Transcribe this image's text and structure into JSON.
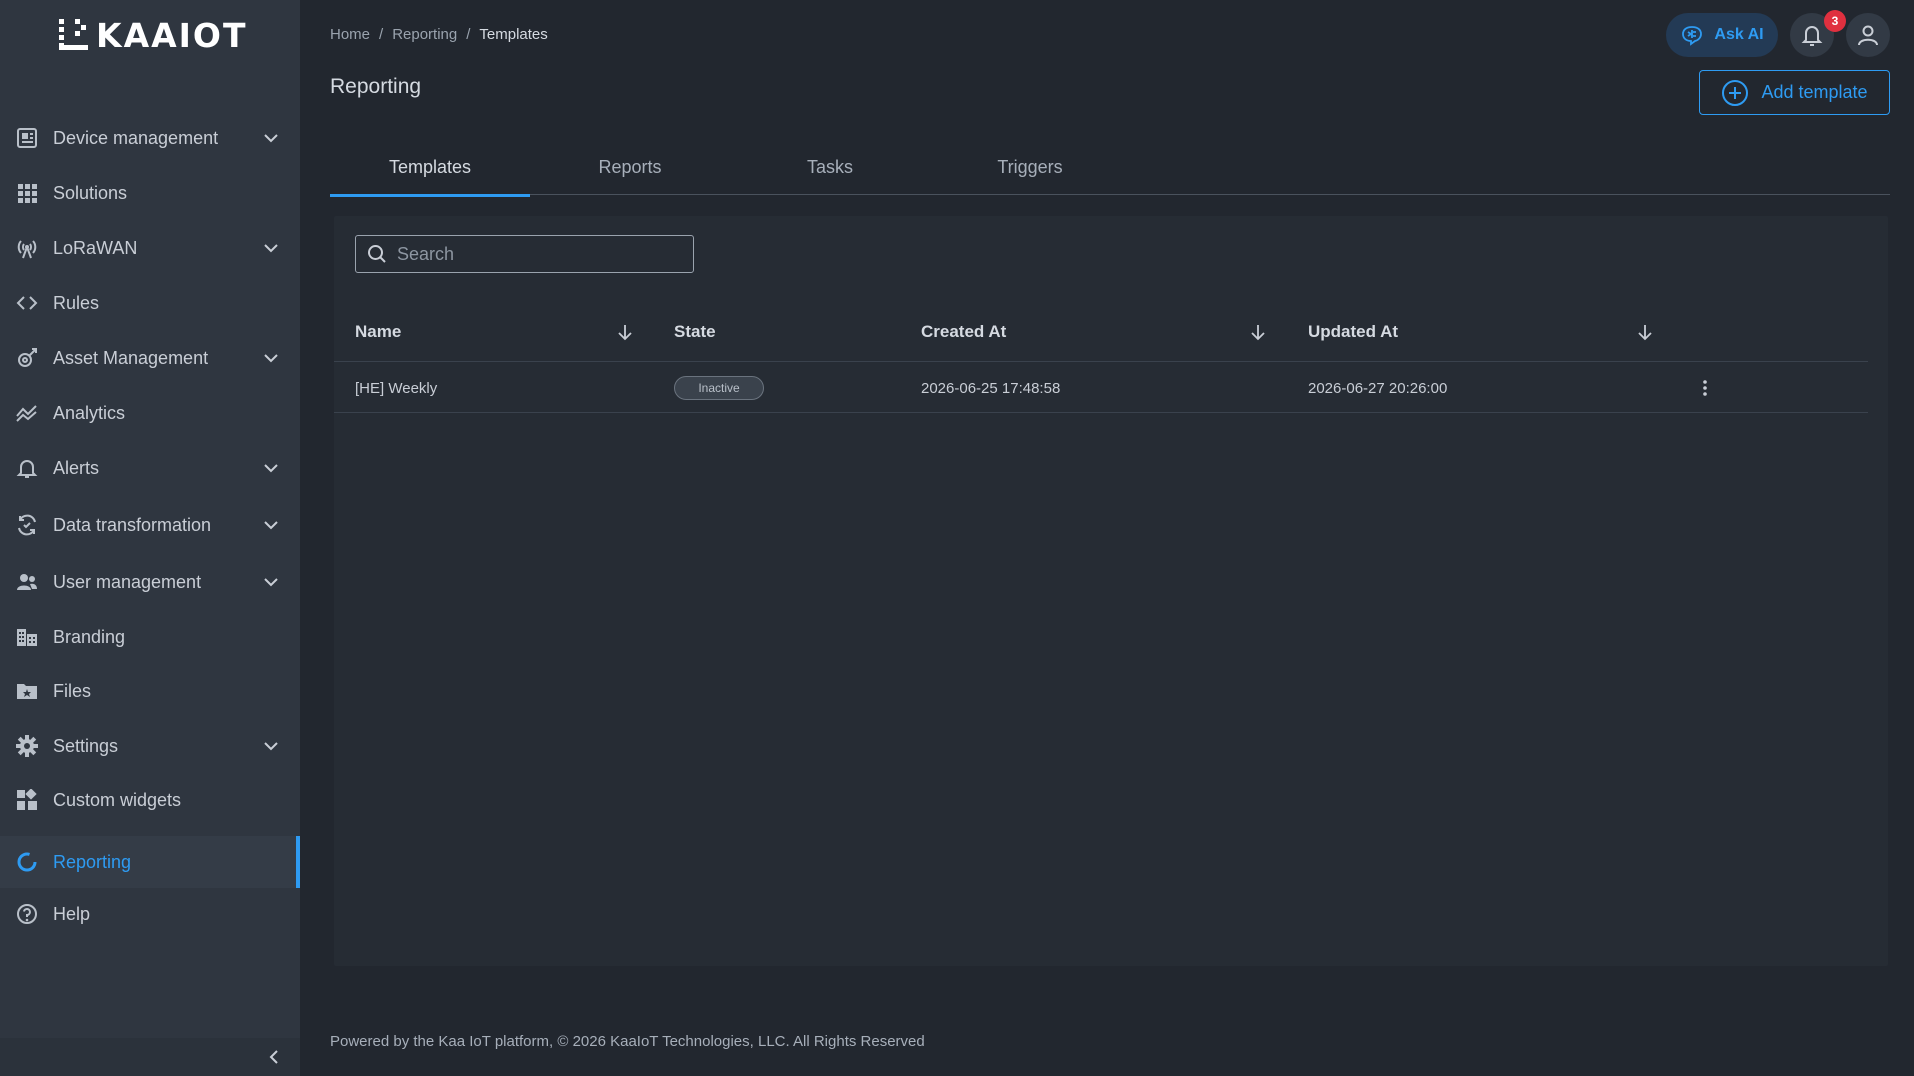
{
  "brand": {
    "logo_text": "KAAIOT",
    "accent_color": "#2e9bf2"
  },
  "sidebar": {
    "items": [
      {
        "label": "Device management",
        "icon": "device-icon",
        "expandable": true
      },
      {
        "label": "Solutions",
        "icon": "grid-icon",
        "expandable": false
      },
      {
        "label": "LoRaWAN",
        "icon": "antenna-icon",
        "expandable": true
      },
      {
        "label": "Rules",
        "icon": "code-icon",
        "expandable": false
      },
      {
        "label": "Asset Management",
        "icon": "asset-icon",
        "expandable": true
      },
      {
        "label": "Analytics",
        "icon": "analytics-icon",
        "expandable": false
      },
      {
        "label": "Alerts",
        "icon": "bell-icon",
        "expandable": true
      },
      {
        "label": "Data transformation",
        "icon": "transform-icon",
        "expandable": true
      },
      {
        "label": "User management",
        "icon": "users-icon",
        "expandable": true
      },
      {
        "label": "Branding",
        "icon": "branding-icon",
        "expandable": false
      },
      {
        "label": "Files",
        "icon": "folder-icon",
        "expandable": false
      },
      {
        "label": "Settings",
        "icon": "gear-icon",
        "expandable": true
      },
      {
        "label": "Custom widgets",
        "icon": "widgets-icon",
        "expandable": false
      },
      {
        "label": "Reporting",
        "icon": "reporting-icon",
        "expandable": false,
        "active": true
      },
      {
        "label": "Help",
        "icon": "help-icon",
        "expandable": false
      }
    ]
  },
  "header": {
    "breadcrumb": [
      "Home",
      "Reporting",
      "Templates"
    ],
    "breadcrumb_separator": "/",
    "title": "Reporting",
    "ask_ai_label": "Ask AI",
    "notification_count": "3",
    "add_template_label": "Add template"
  },
  "tabs": [
    {
      "label": "Templates",
      "active": true
    },
    {
      "label": "Reports",
      "active": false
    },
    {
      "label": "Tasks",
      "active": false
    },
    {
      "label": "Triggers",
      "active": false
    }
  ],
  "table": {
    "search_placeholder": "Search",
    "columns": [
      "Name",
      "State",
      "Created At",
      "Updated At"
    ],
    "rows": [
      {
        "name": "[HE] Weekly",
        "state": "Inactive",
        "created_at": "2026-06-25 17:48:58",
        "updated_at": "2026-06-27 20:26:00"
      }
    ]
  },
  "footer": {
    "text": "Powered by the Kaa IoT platform, © 2026 KaaIoT Technologies, LLC. All Rights Reserved"
  }
}
